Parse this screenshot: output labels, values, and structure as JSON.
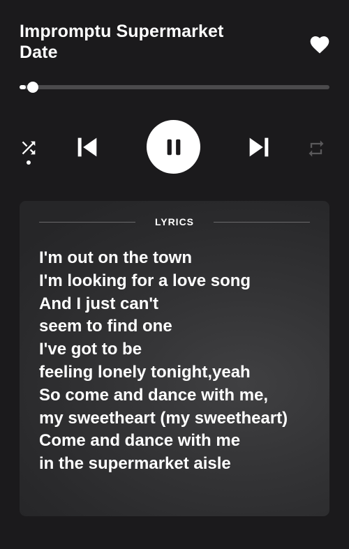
{
  "track": {
    "title_line1": "Impromptu Supermarket",
    "title_line2": "Date",
    "liked": true
  },
  "playback": {
    "progress_fraction": 0.02,
    "state": "playing",
    "shuffle_on": true,
    "repeat_on": false
  },
  "icons": {
    "like": "heart-icon",
    "shuffle": "shuffle-icon",
    "previous": "skip-previous-icon",
    "pause": "pause-icon",
    "next": "skip-next-icon",
    "repeat": "repeat-icon"
  },
  "lyrics": {
    "label": "LYRICS",
    "lines": [
      "I'm out on the town",
      "I'm looking for a love song",
      "And I just can't",
      "seem to find one",
      "I've got to be",
      "feeling lonely tonight,yeah",
      "So come and dance with me,",
      "my sweetheart (my sweetheart)",
      "Come and dance with me",
      "in the supermarket aisle"
    ]
  },
  "colors": {
    "background": "#1b1a1c",
    "card": "#333335",
    "accent": "#ffffff",
    "inactive": "#5a595b",
    "track": "#4b4a4c"
  }
}
